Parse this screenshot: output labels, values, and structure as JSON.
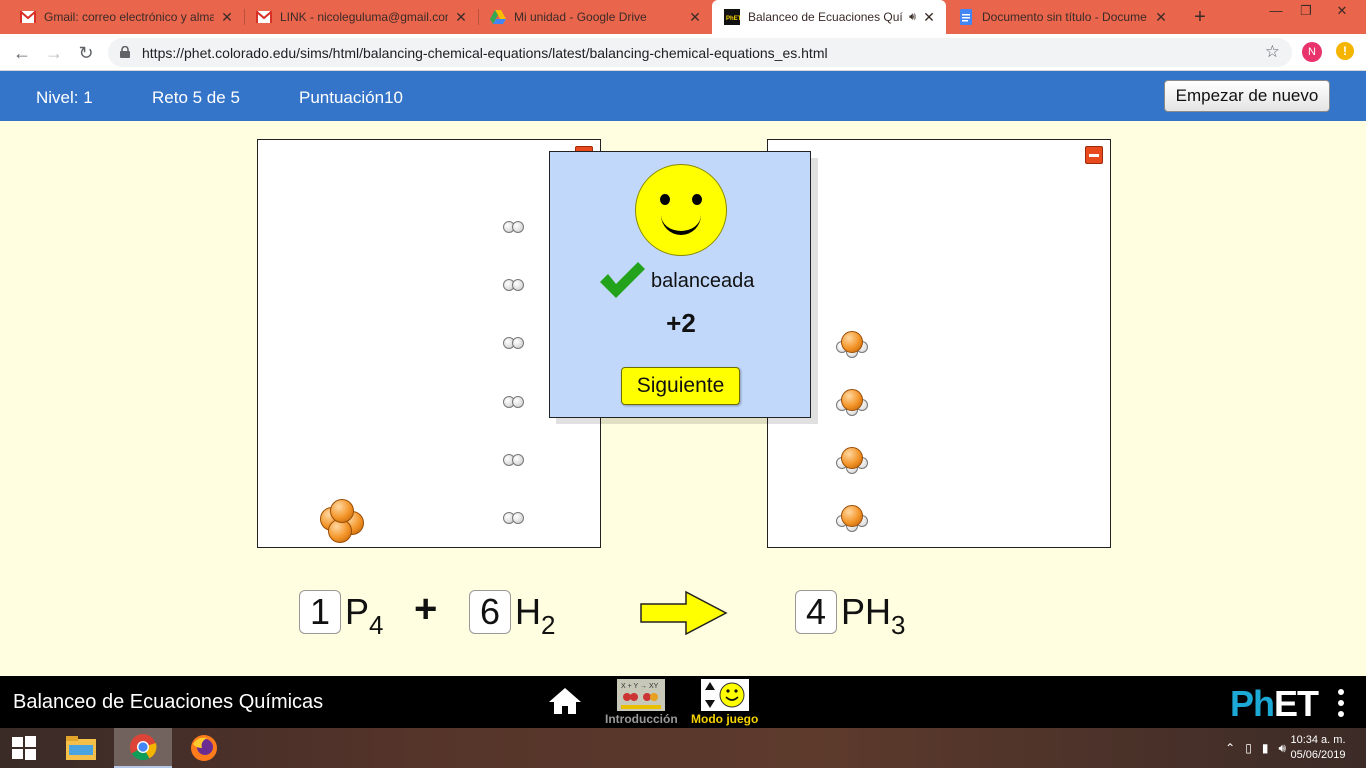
{
  "browser": {
    "tabs": [
      {
        "title": "Gmail: correo electrónico y alma",
        "icon": "gmail-icon",
        "active": false
      },
      {
        "title": "LINK - nicoleguluma@gmail.com",
        "icon": "gmail-icon",
        "active": false
      },
      {
        "title": "Mi unidad - Google Drive",
        "icon": "drive-icon",
        "active": false
      },
      {
        "title": "Balanceo de Ecuaciones Quí",
        "icon": "phet-icon",
        "active": true
      },
      {
        "title": "Documento sin título - Docume",
        "icon": "docs-icon",
        "active": false
      }
    ],
    "url": "https://phet.colorado.edu/sims/html/balancing-chemical-equations/latest/balancing-chemical-equations_es.html",
    "profile_initial": "N",
    "alert_glyph": "!"
  },
  "header": {
    "level": "Nivel: 1",
    "challenge": "Reto 5 de 5",
    "score": "Puntuación10",
    "restart_label": "Empezar de nuevo"
  },
  "dialog": {
    "status": "balanceada",
    "points": "+2",
    "next_label": "Siguiente"
  },
  "equation": {
    "reactants": [
      {
        "coefficient": "1",
        "formula": "P",
        "subscript": "4"
      },
      {
        "coefficient": "6",
        "formula": "H",
        "subscript": "2"
      }
    ],
    "plus": "+",
    "products": [
      {
        "coefficient": "4",
        "formula": "PH",
        "subscript": "3"
      }
    ]
  },
  "molecules": {
    "reactants_box": {
      "P4_count": 1,
      "H2_count": 6
    },
    "products_box": {
      "PH3_count": 4
    }
  },
  "navbar": {
    "sim_title": "Balanceo de Ecuaciones Químicas",
    "screens": [
      {
        "label": "Introducción",
        "active": false
      },
      {
        "label": "Modo juego",
        "active": true
      }
    ],
    "logo_ph": "PhET",
    "intro_icon_text": "X + Y → XY"
  },
  "taskbar": {
    "time": "10:34 a. m.",
    "date": "05/06/2019"
  },
  "colors": {
    "tab_strip": "#e9654b",
    "sim_header": "#3575c9",
    "stage_background": "#fffee0",
    "dialog_background": "#c1d8fb",
    "next_button": "#ffff00",
    "phosphorus": "#f39427",
    "check": "#22a31b"
  }
}
